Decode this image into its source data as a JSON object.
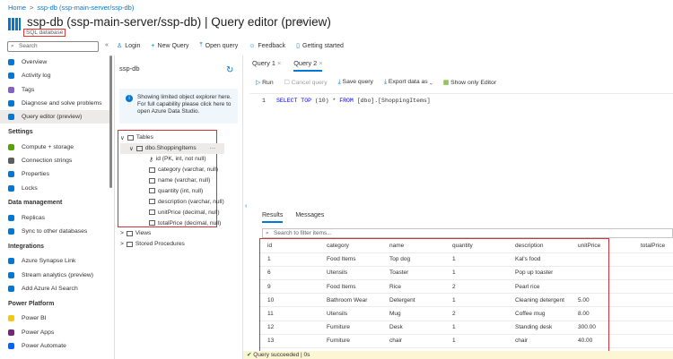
{
  "breadcrumb": [
    "Home",
    ">",
    "ssp-db (ssp-main-server/ssp-db)"
  ],
  "header": {
    "title": "ssp-db (ssp-main-server/ssp-db) | Query editor (preview)",
    "subtitle": "SQL database",
    "star": "☆",
    "more": "···"
  },
  "search": {
    "placeholder": "Search"
  },
  "commands": [
    {
      "icon": "person-icon",
      "glyph": "♙",
      "label": "Login"
    },
    {
      "icon": "plus-icon",
      "glyph": "+",
      "label": "New Query"
    },
    {
      "icon": "upload-icon",
      "glyph": "⤒",
      "label": "Open query"
    },
    {
      "icon": "feedback-icon",
      "glyph": "☺",
      "label": "Feedback"
    },
    {
      "icon": "book-icon",
      "glyph": "▯",
      "label": "Getting started"
    }
  ],
  "nav": [
    {
      "type": "item",
      "label": "Overview",
      "color": "#0078d4"
    },
    {
      "type": "item",
      "label": "Activity log",
      "color": "#0078d4"
    },
    {
      "type": "item",
      "label": "Tags",
      "color": "#8661c5"
    },
    {
      "type": "item",
      "label": "Diagnose and solve problems",
      "color": "#0078d4"
    },
    {
      "type": "item",
      "label": "Query editor (preview)",
      "color": "#0078d4",
      "selected": true
    },
    {
      "type": "sec",
      "label": "Settings"
    },
    {
      "type": "item",
      "label": "Compute + storage",
      "color": "#57a300"
    },
    {
      "type": "item",
      "label": "Connection strings",
      "color": "#605e5c"
    },
    {
      "type": "item",
      "label": "Properties",
      "color": "#0078d4"
    },
    {
      "type": "item",
      "label": "Locks",
      "color": "#0078d4"
    },
    {
      "type": "sec",
      "label": "Data management"
    },
    {
      "type": "item",
      "label": "Replicas",
      "color": "#0078d4"
    },
    {
      "type": "item",
      "label": "Sync to other databases",
      "color": "#0078d4"
    },
    {
      "type": "sec",
      "label": "Integrations"
    },
    {
      "type": "item",
      "label": "Azure Synapse Link",
      "color": "#0078d4"
    },
    {
      "type": "item",
      "label": "Stream analytics (preview)",
      "color": "#0078d4"
    },
    {
      "type": "item",
      "label": "Add Azure AI Search",
      "color": "#0078d4"
    },
    {
      "type": "sec",
      "label": "Power Platform"
    },
    {
      "type": "item",
      "label": "Power BI",
      "color": "#f2c811"
    },
    {
      "type": "item",
      "label": "Power Apps",
      "color": "#742774"
    },
    {
      "type": "item",
      "label": "Power Automate",
      "color": "#0066ff"
    }
  ],
  "explorer": {
    "title": "ssp-db",
    "info": "Showing limited object explorer here. For full capability please click here to open Azure Data Studio.",
    "tree": [
      {
        "label": "Tables",
        "indent": 0,
        "chev": "∨"
      },
      {
        "label": "dbo.ShoppingItems",
        "indent": 1,
        "chev": "∨",
        "more": "···"
      },
      {
        "label": "id (PK, int, not null)",
        "indent": 2,
        "key": true
      },
      {
        "label": "category (varchar, null)",
        "indent": 2
      },
      {
        "label": "name (varchar, null)",
        "indent": 2
      },
      {
        "label": "quantity (int, null)",
        "indent": 2
      },
      {
        "label": "description (varchar, null)",
        "indent": 2
      },
      {
        "label": "unitPrice (decimal, null)",
        "indent": 2
      },
      {
        "label": "totalPrice (decimal, null)",
        "indent": 2
      },
      {
        "label": "Views",
        "indent": 0,
        "chev": ">"
      },
      {
        "label": "Stored Procedures",
        "indent": 0,
        "chev": ">"
      }
    ]
  },
  "tabs": [
    {
      "label": "Query 1",
      "active": false
    },
    {
      "label": "Query 2",
      "active": true
    }
  ],
  "toolbar": {
    "run": "Run",
    "cancel": "Cancel query",
    "save": "Save query",
    "export": "Export data as",
    "show_editor": "Show only Editor"
  },
  "editor": {
    "line": "1",
    "kw1": "SELECT TOP",
    "rest1": " (10) * ",
    "kw2": "FROM",
    "rest2": " [dbo].[ShoppingItems]"
  },
  "results": {
    "tabs": [
      "Results",
      "Messages"
    ],
    "filter_placeholder": "Search to filter items...",
    "columns": [
      "id",
      "category",
      "name",
      "quantity",
      "description",
      "unitPrice",
      "totalPrice"
    ],
    "rows": [
      [
        "1",
        "Food Items",
        "Top dog",
        "1",
        "Kal's food",
        "",
        ""
      ],
      [
        "6",
        "Utensils",
        "Toaster",
        "1",
        "Pop up toaster",
        "",
        ""
      ],
      [
        "9",
        "Food Items",
        "Rice",
        "2",
        "Pearl rice",
        "",
        ""
      ],
      [
        "10",
        "Bathroom Wear",
        "Detergent",
        "1",
        "Cleaning detergent",
        "5.00",
        ""
      ],
      [
        "11",
        "Utensils",
        "Mug",
        "2",
        "Coffee mug",
        "8.00",
        ""
      ],
      [
        "12",
        "Furniture",
        "Desk",
        "1",
        "Standing desk",
        "300.00",
        ""
      ],
      [
        "13",
        "Furniture",
        "chair",
        "1",
        "chair",
        "40.00",
        ""
      ]
    ]
  },
  "status": {
    "icon": "✔",
    "text": "Query succeeded | 0s"
  }
}
